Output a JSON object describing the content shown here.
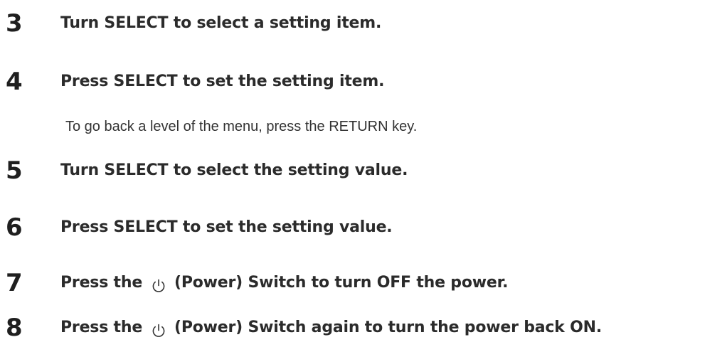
{
  "steps": [
    {
      "number": "3",
      "text": "Turn SELECT to select a setting item."
    },
    {
      "number": "4",
      "text": "Press SELECT to set the setting item."
    },
    {
      "number": "5",
      "text": "Turn SELECT to select the setting value."
    },
    {
      "number": "6",
      "text": "Press SELECT to set the setting value."
    },
    {
      "number": "7",
      "text_before": "Press the",
      "icon": "power-icon",
      "text_after": "(Power) Switch to turn OFF the power."
    },
    {
      "number": "8",
      "text_before": "Press the",
      "icon": "power-icon",
      "text_after": "(Power) Switch again to turn the power back ON."
    }
  ],
  "note": "To go back a level of the menu, press the RETURN key."
}
